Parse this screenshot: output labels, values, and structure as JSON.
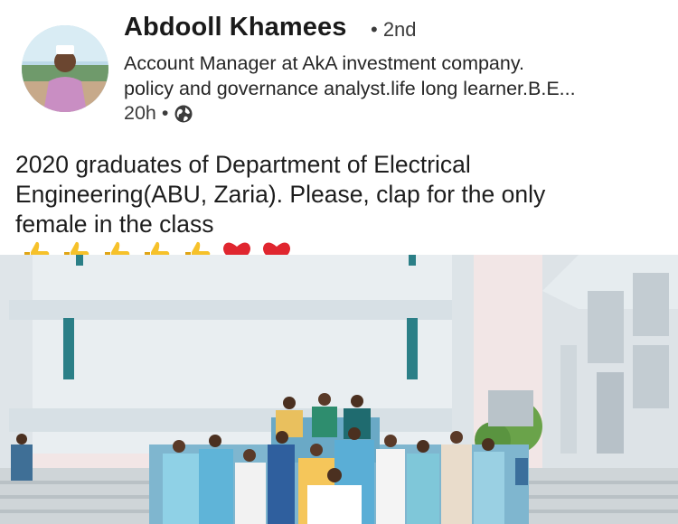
{
  "author": {
    "name": "Abdooll Khamees",
    "degree": "• 2nd",
    "headline_line1": "Account Manager at AkA investment company.",
    "headline_line2": "policy and governance analyst.life long learner.B.E...",
    "time": "20h •",
    "visibility_icon": "globe-icon"
  },
  "post": {
    "line1": "2020 graduates of Department of Electrical",
    "line2": "Engineering(ABU, Zaria). Please, clap for the only",
    "line3": "female in the class",
    "emojis": [
      "thumbs-up",
      "thumbs-up",
      "thumbs-up",
      "thumbs-up",
      "thumbs-up",
      "red-heart",
      "red-heart"
    ]
  },
  "colors": {
    "sky": "#f2e6e6",
    "building": "#e9eef1",
    "thumb": "#f6c12a",
    "heart": "#e0262f"
  }
}
